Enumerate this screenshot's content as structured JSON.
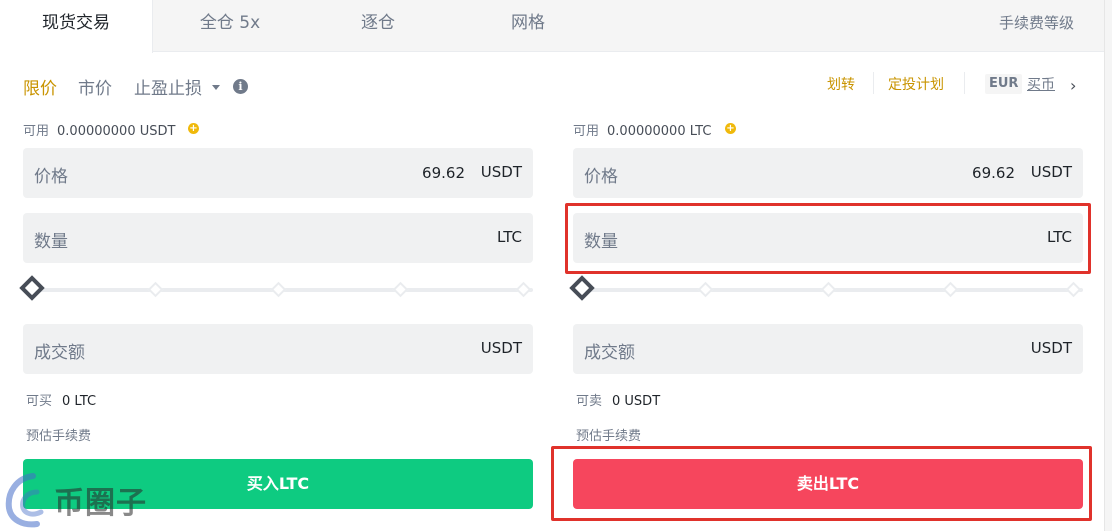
{
  "tabs": [
    {
      "label": "现货交易",
      "active": true
    },
    {
      "label": "全仓 5x",
      "active": false
    },
    {
      "label": "逐仓",
      "active": false
    },
    {
      "label": "网格",
      "active": false
    }
  ],
  "fee_level": "手续费等级",
  "order_types": {
    "limit": "限价",
    "market": "市价",
    "stop": "止盈止损"
  },
  "top_links": {
    "transfer": "划转",
    "recurring_plan": "定投计划",
    "currency": "EUR",
    "buy_crypto": "买币"
  },
  "buy_panel": {
    "available_label": "可用",
    "available_value": "0.00000000 USDT",
    "price_label": "价格",
    "price_value": "69.62",
    "price_unit": "USDT",
    "amount_label": "数量",
    "amount_unit": "LTC",
    "total_label": "成交额",
    "total_unit": "USDT",
    "slider_percent": 0,
    "can_label": "可买",
    "can_value": "0 LTC",
    "fee_label": "预估手续费",
    "button_label": "买入LTC"
  },
  "sell_panel": {
    "available_label": "可用",
    "available_value": "0.00000000 LTC",
    "price_label": "价格",
    "price_value": "69.62",
    "price_unit": "USDT",
    "amount_label": "数量",
    "amount_unit": "LTC",
    "total_label": "成交额",
    "total_unit": "USDT",
    "slider_percent": 0,
    "can_label": "可卖",
    "can_value": "0 USDT",
    "fee_label": "预估手续费",
    "button_label": "卖出LTC"
  },
  "watermark": "币圈子",
  "colors": {
    "accent": "#c99400",
    "buy": "#0ecb81",
    "sell": "#f6465d",
    "highlight_box": "#e0322b"
  }
}
